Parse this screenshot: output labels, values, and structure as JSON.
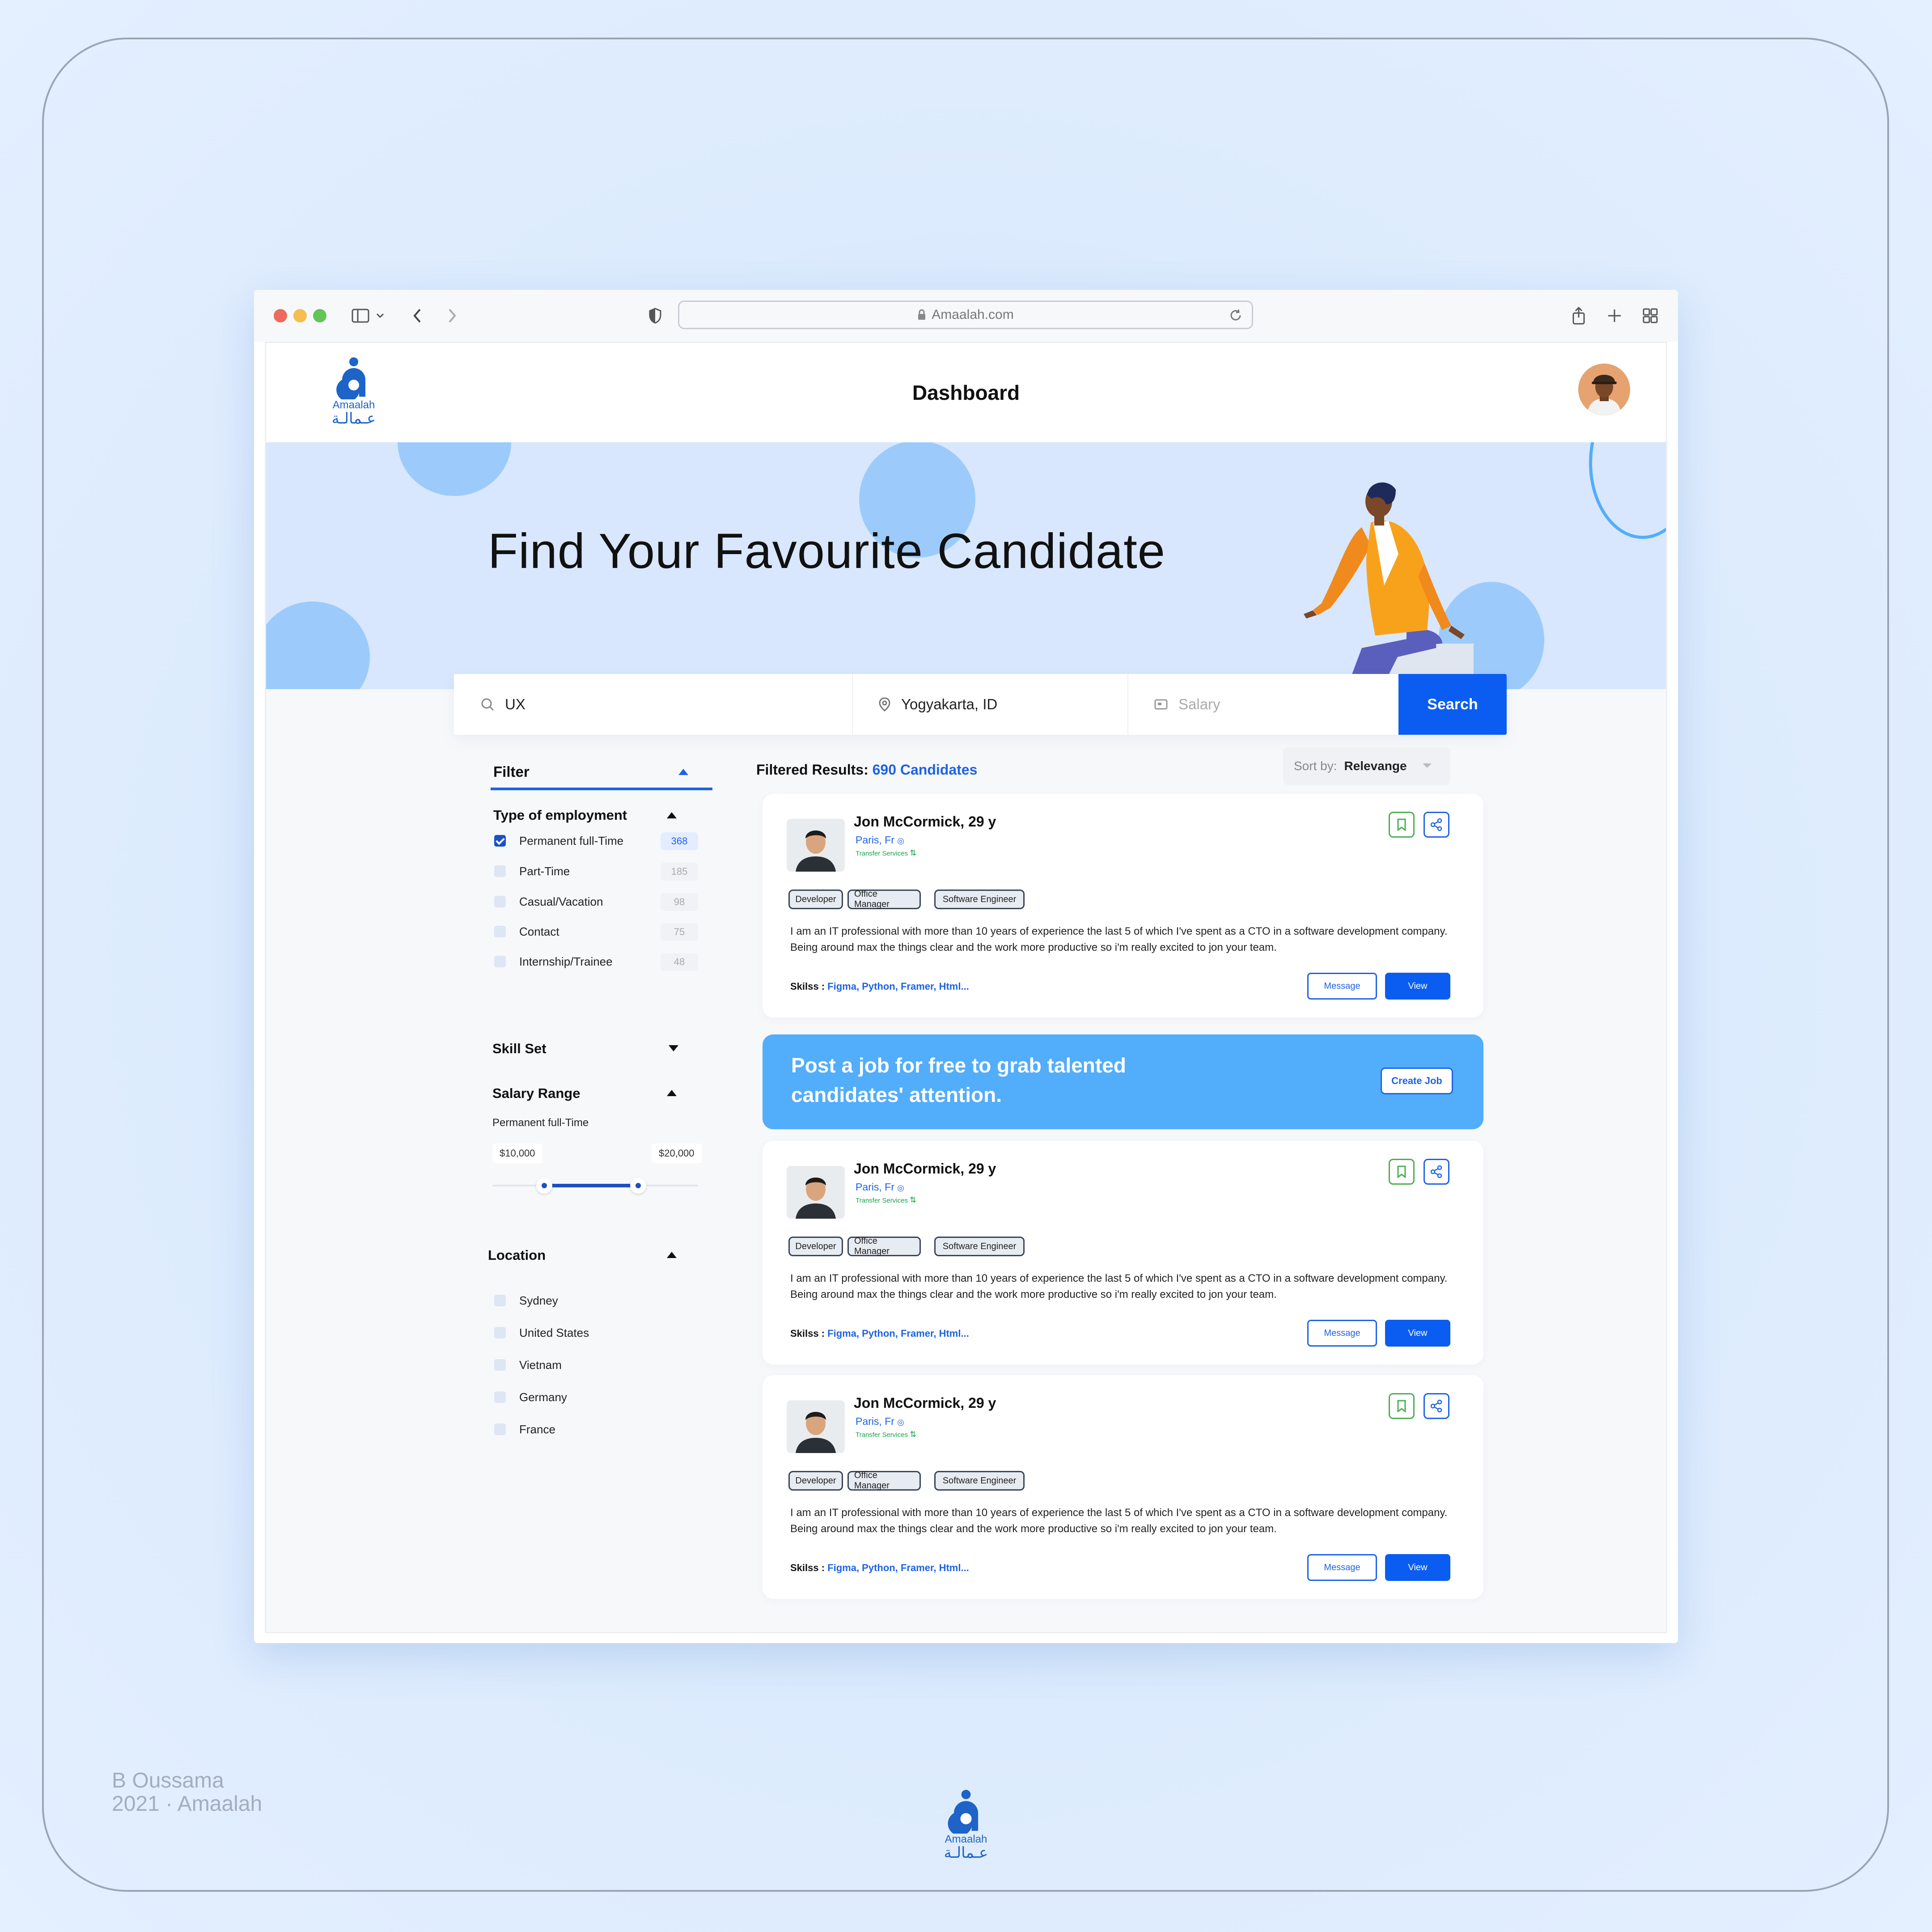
{
  "browser": {
    "url": "Amaalah.com"
  },
  "header": {
    "logo_text": "Amaalah",
    "logo_arabic": "عـمالـة",
    "title": "Dashboard"
  },
  "hero": {
    "title": "Find Your Favourite Candidate"
  },
  "search": {
    "keyword": "UX",
    "location": "Yogyakarta, ID",
    "salary_placeholder": "Salary",
    "button": "Search"
  },
  "filter": {
    "title": "Filter",
    "employment": {
      "title": "Type of employment",
      "options": [
        {
          "label": "Permanent full-Time",
          "count": "368",
          "checked": true
        },
        {
          "label": "Part-Time",
          "count": "185",
          "checked": false
        },
        {
          "label": "Casual/Vacation",
          "count": "98",
          "checked": false
        },
        {
          "label": "Contact",
          "count": "75",
          "checked": false
        },
        {
          "label": "Internship/Trainee",
          "count": "48",
          "checked": false
        }
      ]
    },
    "skill_set": {
      "title": "Skill Set"
    },
    "salary": {
      "title": "Salary Range",
      "subtitle": "Permanent full-Time",
      "min": "$10,000",
      "max": "$20,000"
    },
    "location": {
      "title": "Location",
      "options": [
        "Sydney",
        "United States",
        "Vietnam",
        "Germany",
        "France"
      ]
    }
  },
  "results": {
    "label": "Filtered Results:",
    "count": "690 Candidates",
    "sort_label": "Sort by:",
    "sort_value": "Relevange"
  },
  "candidates": [
    {
      "name": "Jon McCormick, 29 y",
      "location": "Paris, Fr",
      "service": "Transfer Services",
      "tags": [
        "Developer",
        "Office Manager",
        "Software Engineer"
      ],
      "description": "I am an IT professional with more than 10 years of experience the last 5 of which I've spent as a CTO in a software development company. Being around max the things clear and the work more productive so i'm really excited to jon your team.",
      "skills_label": "Skilss :",
      "skills": "Figma, Python, Framer, Html...",
      "message": "Message",
      "view": "View"
    },
    {
      "name": "Jon McCormick, 29 y",
      "location": "Paris, Fr",
      "service": "Transfer Services",
      "tags": [
        "Developer",
        "Office Manager",
        "Software Engineer"
      ],
      "description": "I am an IT professional with more than 10 years of experience the last 5 of which I've spent as a CTO in a software development company. Being around max the things clear and the work more productive so i'm really excited to jon your team.",
      "skills_label": "Skilss :",
      "skills": "Figma, Python, Framer, Html...",
      "message": "Message",
      "view": "View"
    },
    {
      "name": "Jon McCormick, 29 y",
      "location": "Paris, Fr",
      "service": "Transfer Services",
      "tags": [
        "Developer",
        "Office Manager",
        "Software Engineer"
      ],
      "description": "I am an IT professional with more than 10 years of experience the last 5 of which I've spent as a CTO in a software development company. Being around max the things clear and the work more productive so i'm really excited to jon your team.",
      "skills_label": "Skilss :",
      "skills": "Figma, Python, Framer, Html...",
      "message": "Message",
      "view": "View"
    }
  ],
  "promo": {
    "text": "Post a job for free to grab talented candidates' attention.",
    "button": "Create Job"
  },
  "credit": {
    "line1": "B Oussama",
    "line2": "2021 · Amaalah"
  },
  "colors": {
    "primary": "#0a5df0",
    "hero_bg": "#d8e7fd",
    "promo_bg": "#52adfb",
    "logo": "#1e63c8"
  }
}
